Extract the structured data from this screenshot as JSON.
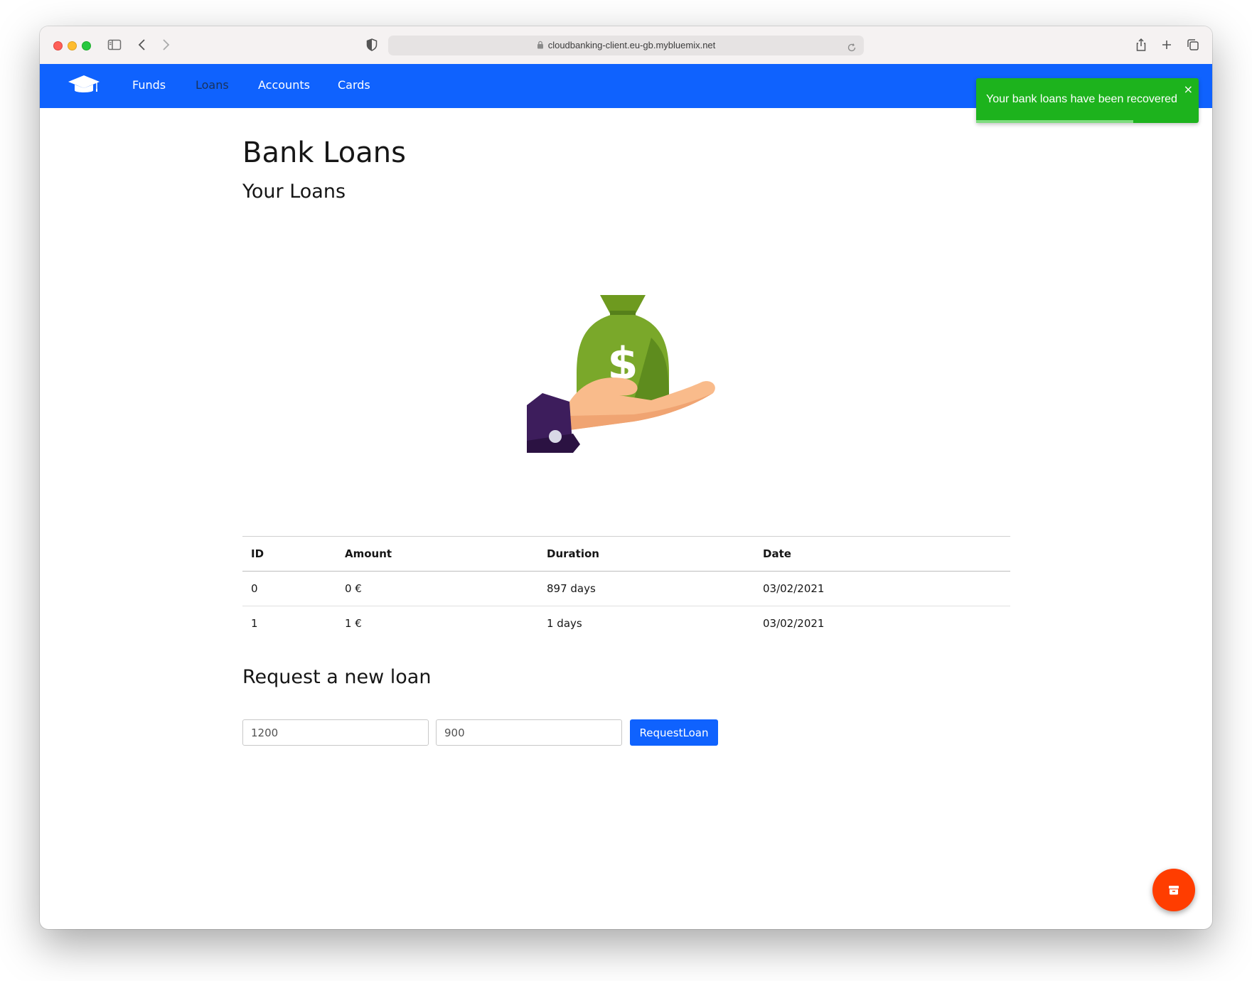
{
  "browser": {
    "url": "cloudbanking-client.eu-gb.mybluemix.net"
  },
  "navbar": {
    "brand_color": "#0f62fe",
    "items": [
      {
        "label": "Funds"
      },
      {
        "label": "Loans"
      },
      {
        "label": "Accounts"
      },
      {
        "label": "Cards"
      }
    ]
  },
  "toast": {
    "message": "Your bank loans have been recovered",
    "close": "×",
    "color": "#1db31d"
  },
  "page": {
    "title": "Bank Loans",
    "subtitle": "Your Loans"
  },
  "loans_table": {
    "headers": [
      "ID",
      "Amount",
      "Duration",
      "Date"
    ],
    "rows": [
      [
        "0",
        "0 €",
        "897 days",
        "03/02/2021"
      ],
      [
        "1",
        "1 €",
        "1 days",
        "03/02/2021"
      ]
    ]
  },
  "request": {
    "title": "Request a new loan",
    "amount_value": "1200",
    "duration_value": "900",
    "button_label": "RequestLoan"
  },
  "fab": {
    "icon": "archive-icon",
    "color": "#ff3d00"
  }
}
